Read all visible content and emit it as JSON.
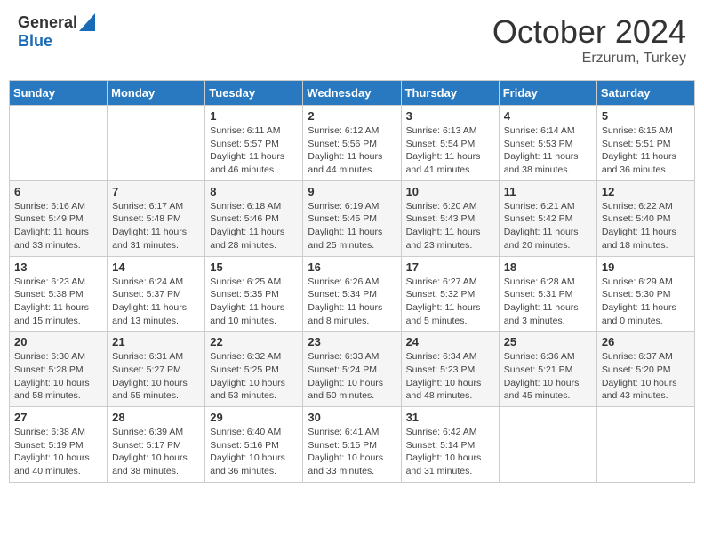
{
  "header": {
    "logo_general": "General",
    "logo_blue": "Blue",
    "month_title": "October 2024",
    "location": "Erzurum, Turkey"
  },
  "days_of_week": [
    "Sunday",
    "Monday",
    "Tuesday",
    "Wednesday",
    "Thursday",
    "Friday",
    "Saturday"
  ],
  "weeks": [
    [
      {
        "day": "",
        "info": ""
      },
      {
        "day": "",
        "info": ""
      },
      {
        "day": "1",
        "info": "Sunrise: 6:11 AM\nSunset: 5:57 PM\nDaylight: 11 hours and 46 minutes."
      },
      {
        "day": "2",
        "info": "Sunrise: 6:12 AM\nSunset: 5:56 PM\nDaylight: 11 hours and 44 minutes."
      },
      {
        "day": "3",
        "info": "Sunrise: 6:13 AM\nSunset: 5:54 PM\nDaylight: 11 hours and 41 minutes."
      },
      {
        "day": "4",
        "info": "Sunrise: 6:14 AM\nSunset: 5:53 PM\nDaylight: 11 hours and 38 minutes."
      },
      {
        "day": "5",
        "info": "Sunrise: 6:15 AM\nSunset: 5:51 PM\nDaylight: 11 hours and 36 minutes."
      }
    ],
    [
      {
        "day": "6",
        "info": "Sunrise: 6:16 AM\nSunset: 5:49 PM\nDaylight: 11 hours and 33 minutes."
      },
      {
        "day": "7",
        "info": "Sunrise: 6:17 AM\nSunset: 5:48 PM\nDaylight: 11 hours and 31 minutes."
      },
      {
        "day": "8",
        "info": "Sunrise: 6:18 AM\nSunset: 5:46 PM\nDaylight: 11 hours and 28 minutes."
      },
      {
        "day": "9",
        "info": "Sunrise: 6:19 AM\nSunset: 5:45 PM\nDaylight: 11 hours and 25 minutes."
      },
      {
        "day": "10",
        "info": "Sunrise: 6:20 AM\nSunset: 5:43 PM\nDaylight: 11 hours and 23 minutes."
      },
      {
        "day": "11",
        "info": "Sunrise: 6:21 AM\nSunset: 5:42 PM\nDaylight: 11 hours and 20 minutes."
      },
      {
        "day": "12",
        "info": "Sunrise: 6:22 AM\nSunset: 5:40 PM\nDaylight: 11 hours and 18 minutes."
      }
    ],
    [
      {
        "day": "13",
        "info": "Sunrise: 6:23 AM\nSunset: 5:38 PM\nDaylight: 11 hours and 15 minutes."
      },
      {
        "day": "14",
        "info": "Sunrise: 6:24 AM\nSunset: 5:37 PM\nDaylight: 11 hours and 13 minutes."
      },
      {
        "day": "15",
        "info": "Sunrise: 6:25 AM\nSunset: 5:35 PM\nDaylight: 11 hours and 10 minutes."
      },
      {
        "day": "16",
        "info": "Sunrise: 6:26 AM\nSunset: 5:34 PM\nDaylight: 11 hours and 8 minutes."
      },
      {
        "day": "17",
        "info": "Sunrise: 6:27 AM\nSunset: 5:32 PM\nDaylight: 11 hours and 5 minutes."
      },
      {
        "day": "18",
        "info": "Sunrise: 6:28 AM\nSunset: 5:31 PM\nDaylight: 11 hours and 3 minutes."
      },
      {
        "day": "19",
        "info": "Sunrise: 6:29 AM\nSunset: 5:30 PM\nDaylight: 11 hours and 0 minutes."
      }
    ],
    [
      {
        "day": "20",
        "info": "Sunrise: 6:30 AM\nSunset: 5:28 PM\nDaylight: 10 hours and 58 minutes."
      },
      {
        "day": "21",
        "info": "Sunrise: 6:31 AM\nSunset: 5:27 PM\nDaylight: 10 hours and 55 minutes."
      },
      {
        "day": "22",
        "info": "Sunrise: 6:32 AM\nSunset: 5:25 PM\nDaylight: 10 hours and 53 minutes."
      },
      {
        "day": "23",
        "info": "Sunrise: 6:33 AM\nSunset: 5:24 PM\nDaylight: 10 hours and 50 minutes."
      },
      {
        "day": "24",
        "info": "Sunrise: 6:34 AM\nSunset: 5:23 PM\nDaylight: 10 hours and 48 minutes."
      },
      {
        "day": "25",
        "info": "Sunrise: 6:36 AM\nSunset: 5:21 PM\nDaylight: 10 hours and 45 minutes."
      },
      {
        "day": "26",
        "info": "Sunrise: 6:37 AM\nSunset: 5:20 PM\nDaylight: 10 hours and 43 minutes."
      }
    ],
    [
      {
        "day": "27",
        "info": "Sunrise: 6:38 AM\nSunset: 5:19 PM\nDaylight: 10 hours and 40 minutes."
      },
      {
        "day": "28",
        "info": "Sunrise: 6:39 AM\nSunset: 5:17 PM\nDaylight: 10 hours and 38 minutes."
      },
      {
        "day": "29",
        "info": "Sunrise: 6:40 AM\nSunset: 5:16 PM\nDaylight: 10 hours and 36 minutes."
      },
      {
        "day": "30",
        "info": "Sunrise: 6:41 AM\nSunset: 5:15 PM\nDaylight: 10 hours and 33 minutes."
      },
      {
        "day": "31",
        "info": "Sunrise: 6:42 AM\nSunset: 5:14 PM\nDaylight: 10 hours and 31 minutes."
      },
      {
        "day": "",
        "info": ""
      },
      {
        "day": "",
        "info": ""
      }
    ]
  ]
}
